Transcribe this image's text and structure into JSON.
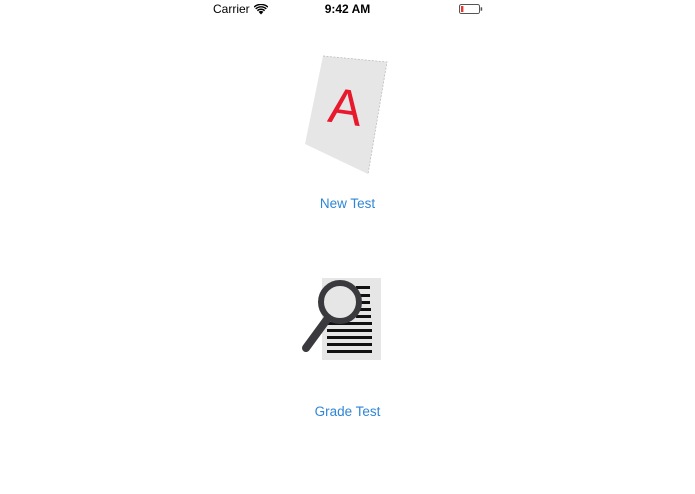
{
  "status_bar": {
    "carrier": "Carrier",
    "time": "9:42 AM",
    "battery_color": "#e53935"
  },
  "menu": {
    "new_test": {
      "label": "New Test",
      "icon": "graded-paper-icon",
      "icon_letter": "A",
      "icon_letter_color": "#e8192c"
    },
    "grade_test": {
      "label": "Grade Test",
      "icon": "magnifier-document-icon"
    }
  },
  "colors": {
    "link": "#2f86d6",
    "paper": "#e6e6e6",
    "magnifier": "#3a3a3e"
  }
}
